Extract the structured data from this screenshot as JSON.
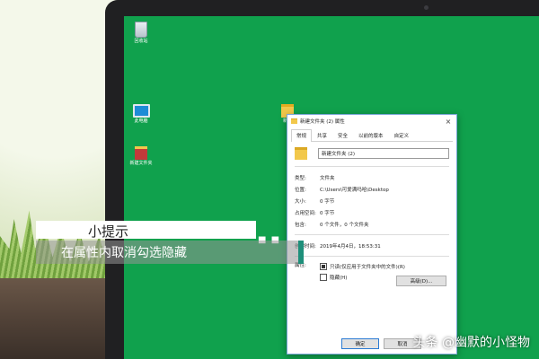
{
  "desktop": {
    "icons": [
      {
        "label": "回收站",
        "icon": "recycle-bin-icon"
      },
      {
        "label": "此电脑",
        "icon": "computer-icon"
      },
      {
        "label": "新建文件夹",
        "icon": "folder-icon"
      },
      {
        "label": "新建",
        "icon": "folder-icon"
      }
    ]
  },
  "window": {
    "title": "新建文件夹 (2) 属性",
    "close_glyph": "×",
    "tabs": [
      "常规",
      "共享",
      "安全",
      "以前的版本",
      "自定义"
    ],
    "active_tab": 0,
    "name_value": "新建文件夹 (2)",
    "properties": [
      {
        "key": "类型:",
        "value": "文件夹"
      },
      {
        "key": "位置:",
        "value": "C:\\Users\\可爱满吗哈\\Desktop"
      },
      {
        "key": "大小:",
        "value": "0 字节"
      },
      {
        "key": "占用空间:",
        "value": "0 字节"
      },
      {
        "key": "包含:",
        "value": "0 个文件，0 个文件夹"
      },
      {
        "key": "创建时间:",
        "value": "2019年4月4日，18:53:31"
      }
    ],
    "attributes_label": "属性:",
    "readonly_label": "只读(仅应用于文件夹中的文件)(R)",
    "hidden_label": "隐藏(H)",
    "advanced_label": "高级(D)...",
    "ok_label": "确定",
    "cancel_label": "取消"
  },
  "tip": {
    "title": "小提示",
    "text": "在属性内取消勾选隐藏",
    "dots": "■ ■"
  },
  "watermark": "头条 @幽默的小怪物",
  "colors": {
    "desktop": "#10a14d",
    "accent_bar": "#1e8f7a"
  }
}
